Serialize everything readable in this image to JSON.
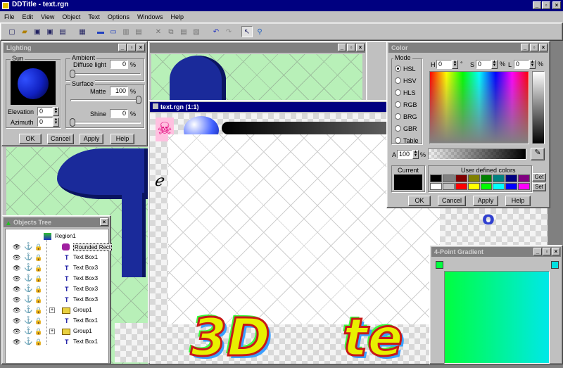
{
  "app": {
    "title": "DDTitle - text.rgn"
  },
  "menu": [
    "File",
    "Edit",
    "View",
    "Object",
    "Text",
    "Options",
    "Windows",
    "Help"
  ],
  "toolbar": {
    "icons": [
      "new-icon",
      "open-icon",
      "save-icon",
      "save-as-icon",
      "print-icon",
      "import-icon",
      "image-icon",
      "image-edit-icon",
      "image-export-icon",
      "cut-icon",
      "copy-icon",
      "paste-icon",
      "delete-icon",
      "undo-icon",
      "redo-icon",
      "select-arrow-icon",
      "zoom-icon"
    ]
  },
  "lighting": {
    "title": "Lighting",
    "sun_label": "Sun",
    "elevation_label": "Elevation",
    "elevation_value": "0",
    "azimuth_label": "Azimuth",
    "azimuth_value": "0",
    "ambient_label": "Ambient",
    "diffuse_label": "Diffuse light",
    "diffuse_value": "0",
    "diffuse_unit": "%",
    "surface_label": "Surface",
    "matte_label": "Matte",
    "matte_value": "100",
    "matte_unit": "%",
    "shine_label": "Shine",
    "shine_value": "0",
    "shine_unit": "%",
    "buttons": {
      "ok": "OK",
      "cancel": "Cancel",
      "apply": "Apply",
      "help": "Help"
    }
  },
  "doc_window": {
    "title": "text.rgn  (1:1)",
    "text_3d": "3D",
    "text_te": "te"
  },
  "color": {
    "title": "Color",
    "mode_label": "Mode",
    "modes": [
      "HSL",
      "HSV",
      "HLS",
      "RGB",
      "BRG",
      "GBR",
      "Table"
    ],
    "selected_mode": "HSL",
    "h_label": "H",
    "h_value": "0",
    "h_unit": "°",
    "s_label": "S",
    "s_value": "0",
    "s_unit": "%",
    "l_label": "L",
    "l_value": "0",
    "l_unit": "%",
    "a_label": "A",
    "a_value": "100",
    "a_unit": "%",
    "current_label": "Current",
    "user_defined_label": "User defined colors",
    "get_label": "Get",
    "set_label": "Set",
    "swatches": [
      "#000000",
      "#808080",
      "#800000",
      "#808000",
      "#008000",
      "#008080",
      "#000080",
      "#800080",
      "#ffffff",
      "#c0c0c0",
      "#ff0000",
      "#ffff00",
      "#00ff00",
      "#00ffff",
      "#0000ff",
      "#ff00ff"
    ],
    "buttons": {
      "ok": "OK",
      "cancel": "Cancel",
      "apply": "Apply",
      "help": "Help"
    }
  },
  "objects_tree": {
    "title": "Objects Tree",
    "root": "Region1",
    "items": [
      "Rounded Rect",
      "Text Box1",
      "Text Box3",
      "Text Box3",
      "Text Box3",
      "Text Box3",
      "Group1",
      "Text Box1",
      "Group1",
      "Text Box1"
    ]
  },
  "gradient": {
    "title": "4-Point Gradient"
  },
  "colors": {
    "accent": "#000080",
    "chrome": "#c0c0c0"
  }
}
